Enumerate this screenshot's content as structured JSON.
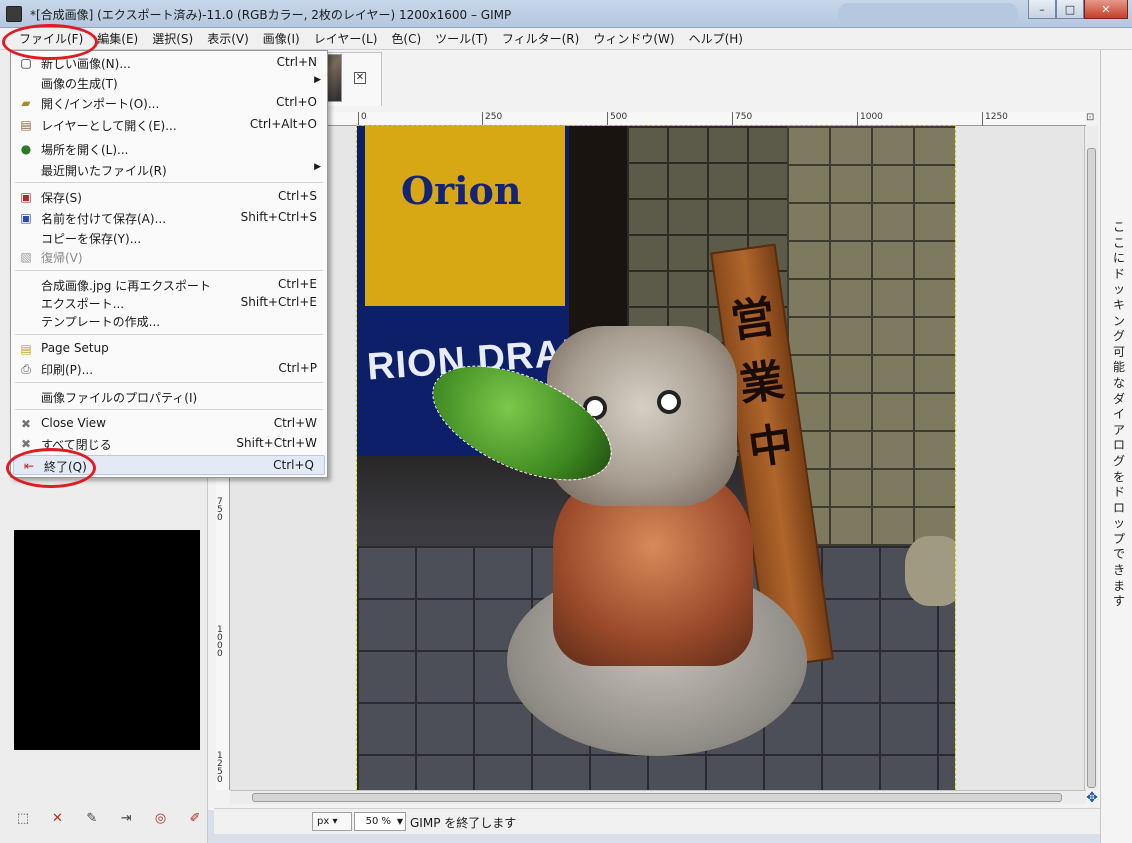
{
  "window": {
    "title": "*[合成画像] (エクスポート済み)-11.0 (RGBカラー, 2枚のレイヤー) 1200x1600 – GIMP",
    "controls": {
      "minimize": "–",
      "maximize": "□",
      "close": "✕"
    }
  },
  "menubar": [
    "ファイル(F)",
    "編集(E)",
    "選択(S)",
    "表示(V)",
    "画像(I)",
    "レイヤー(L)",
    "色(C)",
    "ツール(T)",
    "フィルター(R)",
    "ウィンドウ(W)",
    "ヘルプ(H)"
  ],
  "file_menu": {
    "items": [
      {
        "label": "新しい画像(N)...",
        "shortcut": "Ctrl+N",
        "icon": "new-icon"
      },
      {
        "label": "画像の生成(T)",
        "submenu": true
      },
      {
        "label": "開く/インポート(O)...",
        "shortcut": "Ctrl+O",
        "icon": "open-icon"
      },
      {
        "label": "レイヤーとして開く(E)...",
        "shortcut": "Ctrl+Alt+O",
        "icon": "open-layer-icon"
      },
      {
        "label": "場所を開く(L)...",
        "icon": "globe-icon"
      },
      {
        "label": "最近開いたファイル(R)",
        "submenu": true
      },
      {
        "label": "保存(S)",
        "shortcut": "Ctrl+S",
        "icon": "save-icon"
      },
      {
        "label": "名前を付けて保存(A)...",
        "shortcut": "Shift+Ctrl+S",
        "icon": "save-as-icon"
      },
      {
        "label": "コピーを保存(Y)..."
      },
      {
        "label": "復帰(V)",
        "icon": "revert-icon",
        "disabled": true
      },
      {
        "label": "合成画像.jpg に再エクスポート",
        "shortcut": "Ctrl+E"
      },
      {
        "label": "エクスポート...",
        "shortcut": "Shift+Ctrl+E"
      },
      {
        "label": "テンプレートの作成..."
      },
      {
        "label": "Page Setup",
        "icon": "page-setup-icon"
      },
      {
        "label": "印刷(P)...",
        "shortcut": "Ctrl+P",
        "icon": "print-icon"
      },
      {
        "label": "画像ファイルのプロパティ(I)"
      },
      {
        "label": "Close View",
        "shortcut": "Ctrl+W",
        "icon": "close-view-icon"
      },
      {
        "label": "すべて閉じる",
        "shortcut": "Shift+Ctrl+W",
        "icon": "close-all-icon"
      },
      {
        "label": "終了(Q)",
        "shortcut": "Ctrl+Q",
        "icon": "quit-icon",
        "highlighted": true
      }
    ]
  },
  "ruler": {
    "h_ticks": [
      "0",
      "250",
      "500",
      "750",
      "1000",
      "1250"
    ],
    "v_ticks": [
      "750",
      "1000",
      "1250"
    ]
  },
  "photo_text": {
    "brand": "Orion",
    "banner": "RION DRAFT",
    "sign": "営業中"
  },
  "statusbar": {
    "unit": "px",
    "zoom": "50 %",
    "message": "GIMP を終了します"
  },
  "right_dock_text": "ここにドッキング可能なダイアログをドロップできます",
  "annotation_color": "#e01b24"
}
